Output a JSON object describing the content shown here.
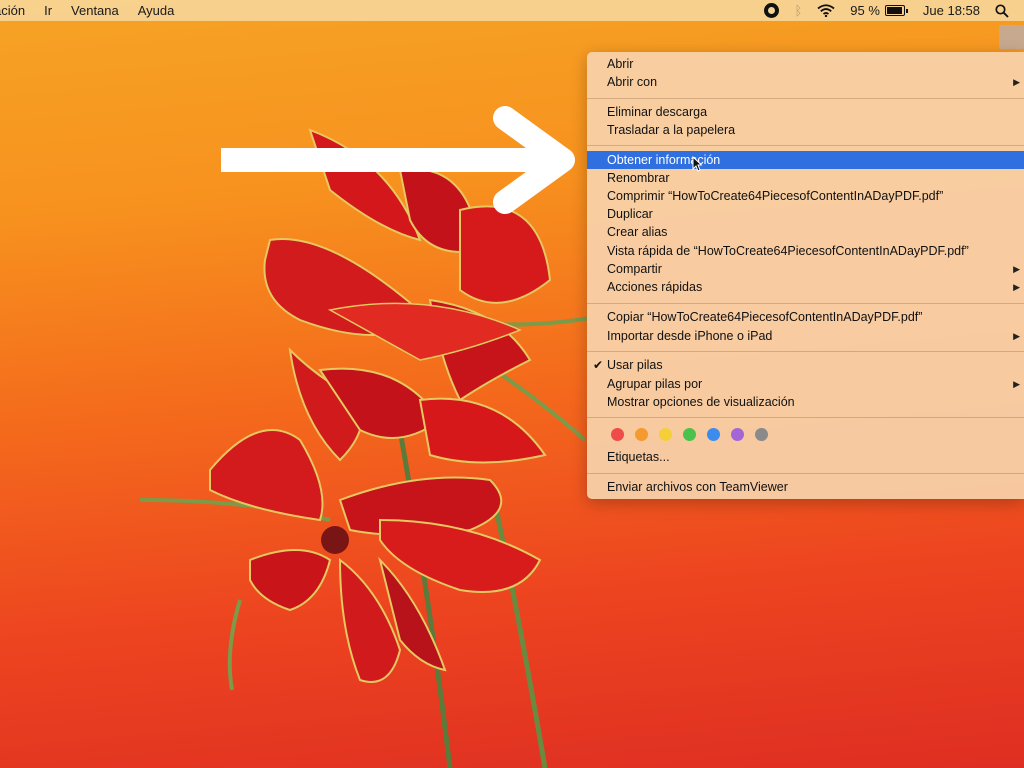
{
  "menubar": {
    "items": [
      "ación",
      "Ir",
      "Ventana",
      "Ayuda"
    ],
    "battery": "95 %",
    "battery_level": 0.95,
    "clock": "Jue 18:58",
    "icons": [
      "stop-circle-icon",
      "bluetooth-icon",
      "wifi-icon",
      "battery-icon",
      "search-icon"
    ]
  },
  "context_menu": {
    "open": "Abrir",
    "open_with": "Abrir con",
    "delete_download": "Eliminar descarga",
    "move_trash": "Trasladar a la papelera",
    "get_info": "Obtener información",
    "rename": "Renombrar",
    "compress": "Comprimir “HowToCreate64PiecesofContentInADayPDF.pdf”",
    "duplicate": "Duplicar",
    "make_alias": "Crear alias",
    "quick_look": "Vista rápida de “HowToCreate64PiecesofContentInADayPDF.pdf”",
    "share": "Compartir",
    "quick_actions": "Acciones rápidas",
    "copy": "Copiar “HowToCreate64PiecesofContentInADayPDF.pdf”",
    "import_iphone": "Importar desde iPhone o iPad",
    "use_stacks": "Usar pilas",
    "group_stacks": "Agrupar pilas por",
    "view_options": "Mostrar opciones de visualización",
    "tags_label": "Etiquetas...",
    "teamviewer": "Enviar archivos con TeamViewer",
    "tag_colors": [
      "#f04b4b",
      "#f59a2e",
      "#f4cf3a",
      "#4bc24b",
      "#3c8cf0",
      "#a466d6",
      "#8a8a8a"
    ],
    "highlight_color": "#2f6fe0"
  }
}
